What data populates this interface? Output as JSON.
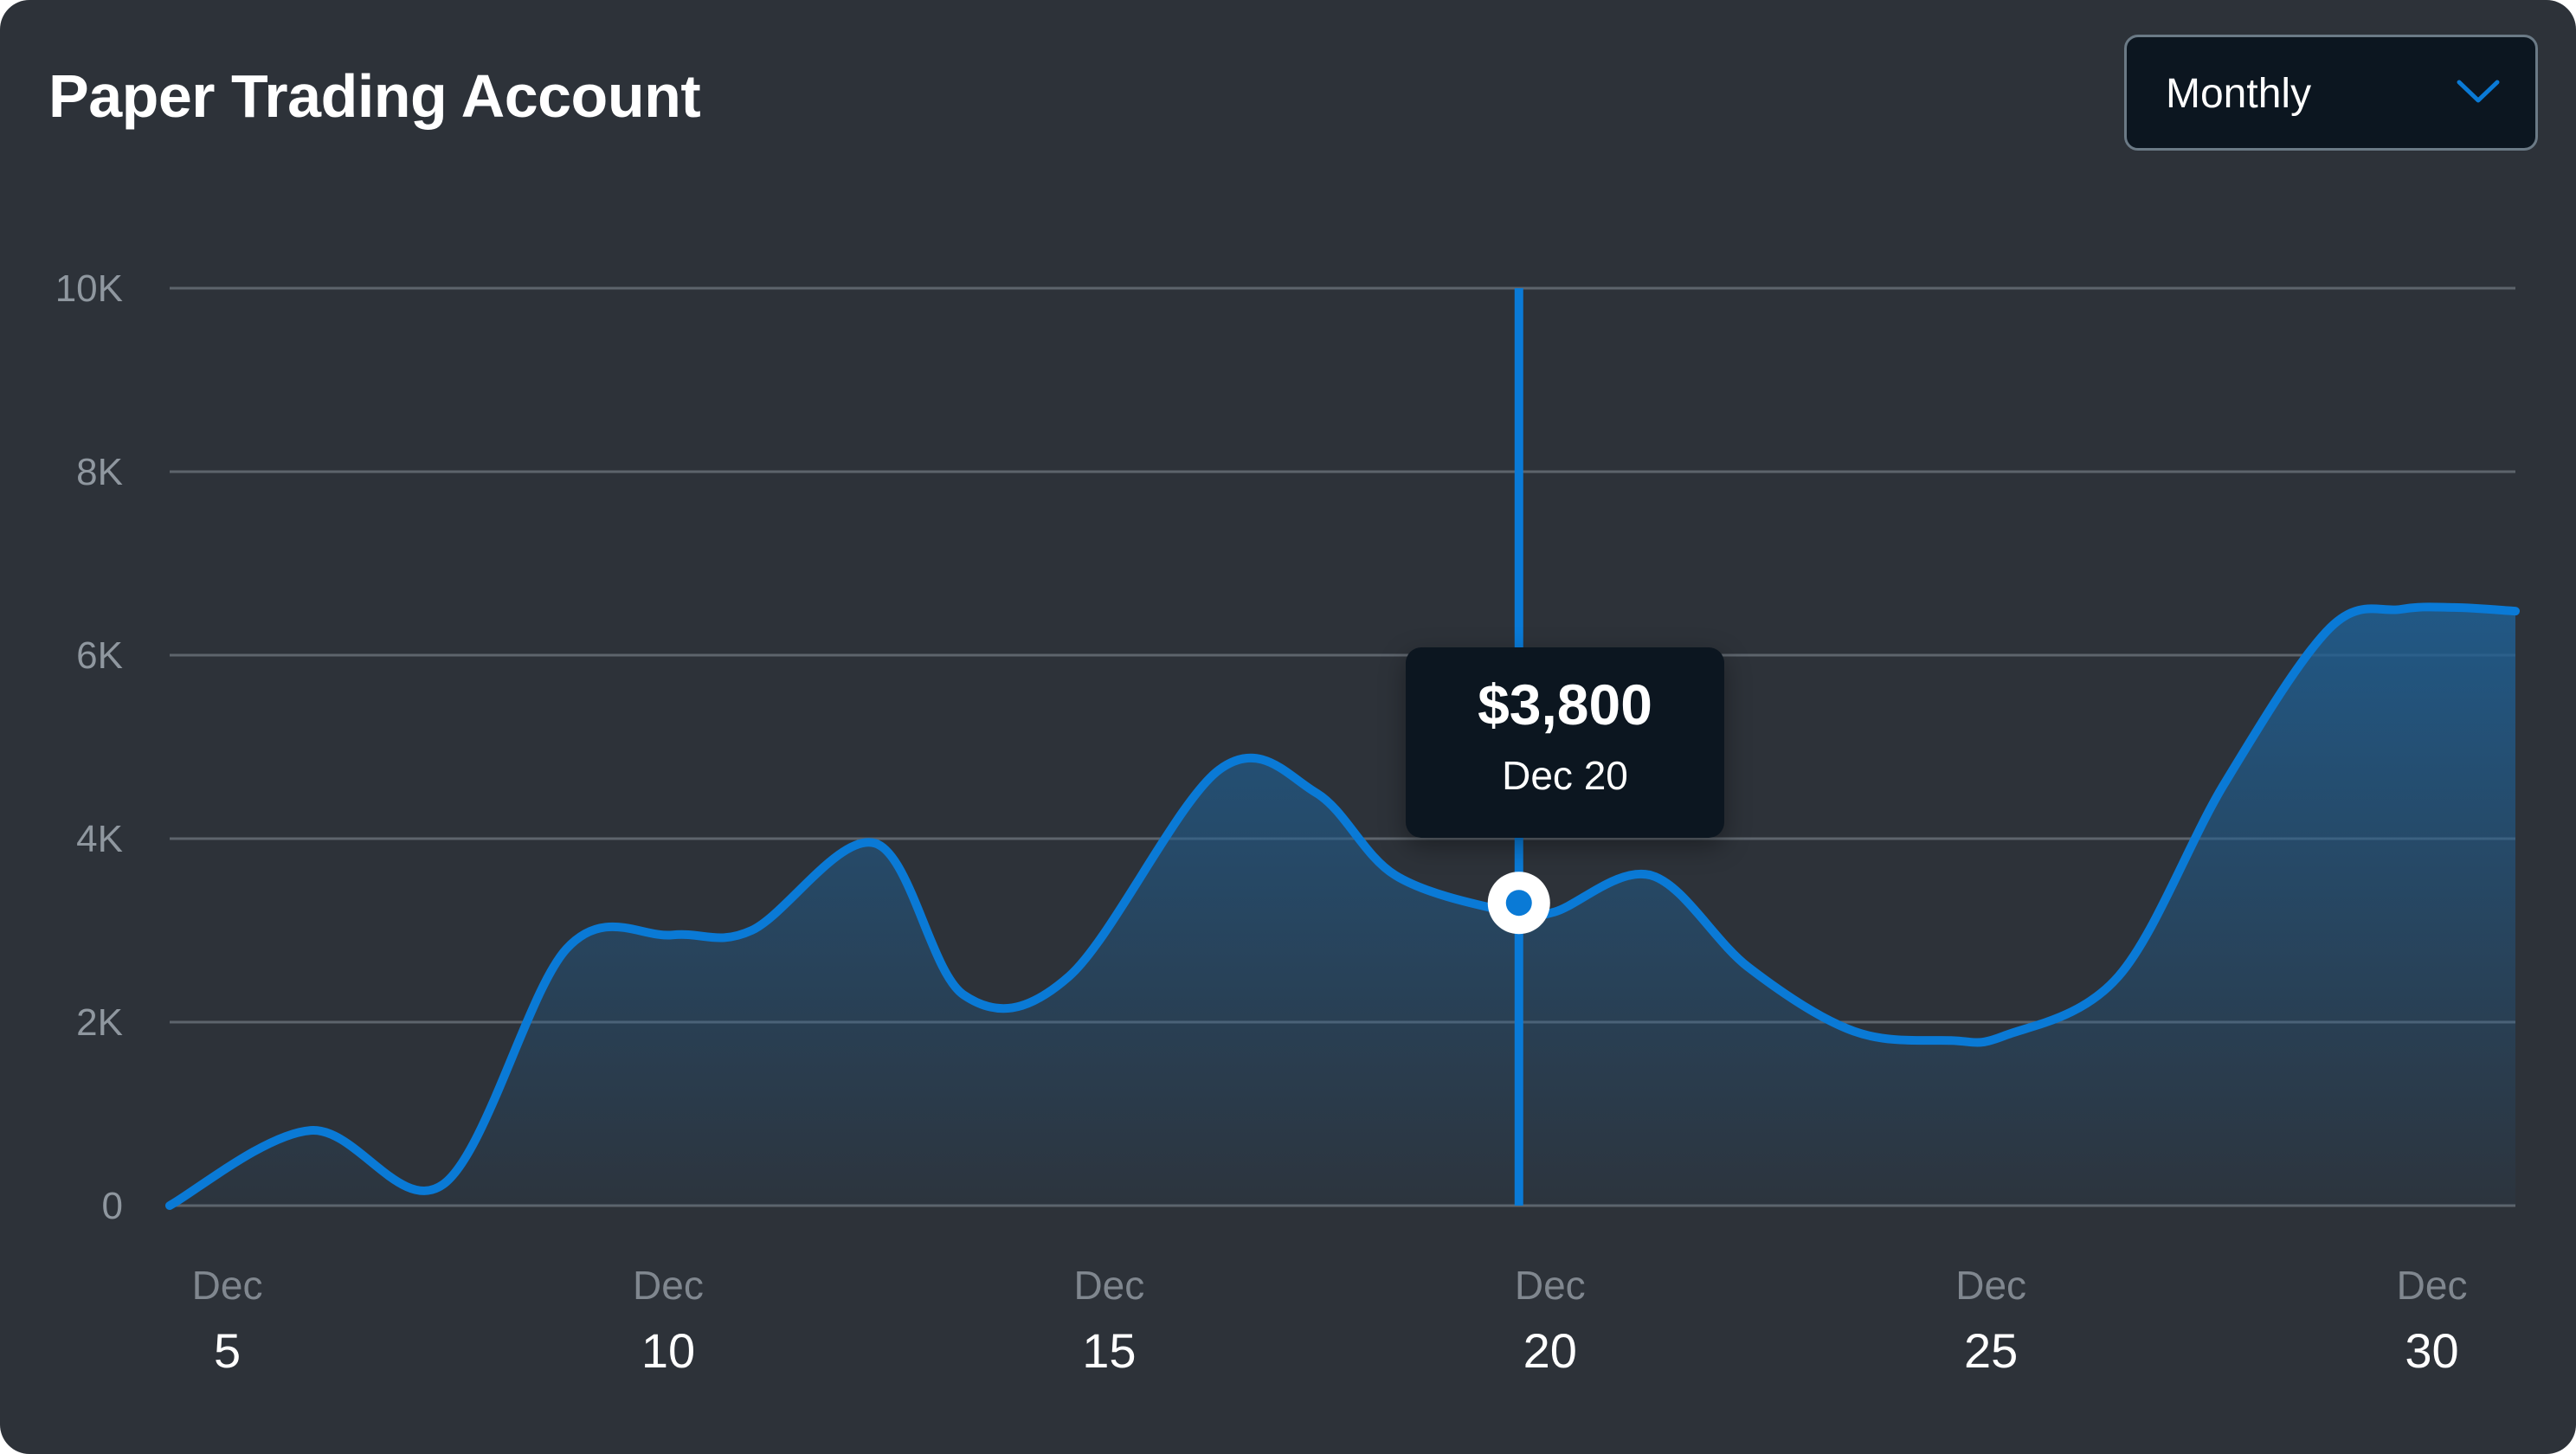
{
  "header": {
    "title": "Paper Trading Account",
    "period_selector": {
      "selected": "Monthly",
      "icon": "chevron-down-icon"
    }
  },
  "colors": {
    "background": "#2d3239",
    "line": "#0a7ad6",
    "grid": "#5d646c",
    "tooltip_bg": "#0c1620"
  },
  "tooltip": {
    "value": "$3,800",
    "date": "Dec 20"
  },
  "chart_data": {
    "type": "area",
    "title": "Paper Trading Account",
    "xlabel": "",
    "ylabel": "",
    "x_ticks": [
      {
        "month": "Dec",
        "day": "5",
        "x": 5
      },
      {
        "month": "Dec",
        "day": "10",
        "x": 10
      },
      {
        "month": "Dec",
        "day": "15",
        "x": 15
      },
      {
        "month": "Dec",
        "day": "20",
        "x": 20
      },
      {
        "month": "Dec",
        "day": "25",
        "x": 25
      },
      {
        "month": "Dec",
        "day": "30",
        "x": 30
      }
    ],
    "y_ticks": [
      {
        "label": "0",
        "value": 0
      },
      {
        "label": "2K",
        "value": 2000
      },
      {
        "label": "4K",
        "value": 4000
      },
      {
        "label": "6K",
        "value": 6000
      },
      {
        "label": "8K",
        "value": 8000
      },
      {
        "label": "10K",
        "value": 10000
      }
    ],
    "xlim": [
      4.7,
      31.3
    ],
    "ylim": [
      0,
      10000
    ],
    "grid": true,
    "highlight": {
      "x": 20,
      "y": 3300
    },
    "series": [
      {
        "x": [
          4.7,
          6.3,
          7.8,
          9.2,
          10.4,
          11.3,
          12.7,
          13.7,
          14.9,
          16.6,
          17.7,
          18.6,
          19.9,
          20.4,
          21.5,
          22.6,
          23.8,
          24.9,
          25.5,
          26.8,
          28.0,
          29.2,
          30.0,
          30.6,
          31.3
        ],
        "y": [
          0,
          820,
          230,
          2800,
          2950,
          3000,
          3950,
          2300,
          2500,
          4750,
          4500,
          3600,
          3200,
          3200,
          3600,
          2600,
          1900,
          1800,
          1850,
          2500,
          4600,
          6300,
          6500,
          6520,
          6480
        ]
      }
    ]
  }
}
